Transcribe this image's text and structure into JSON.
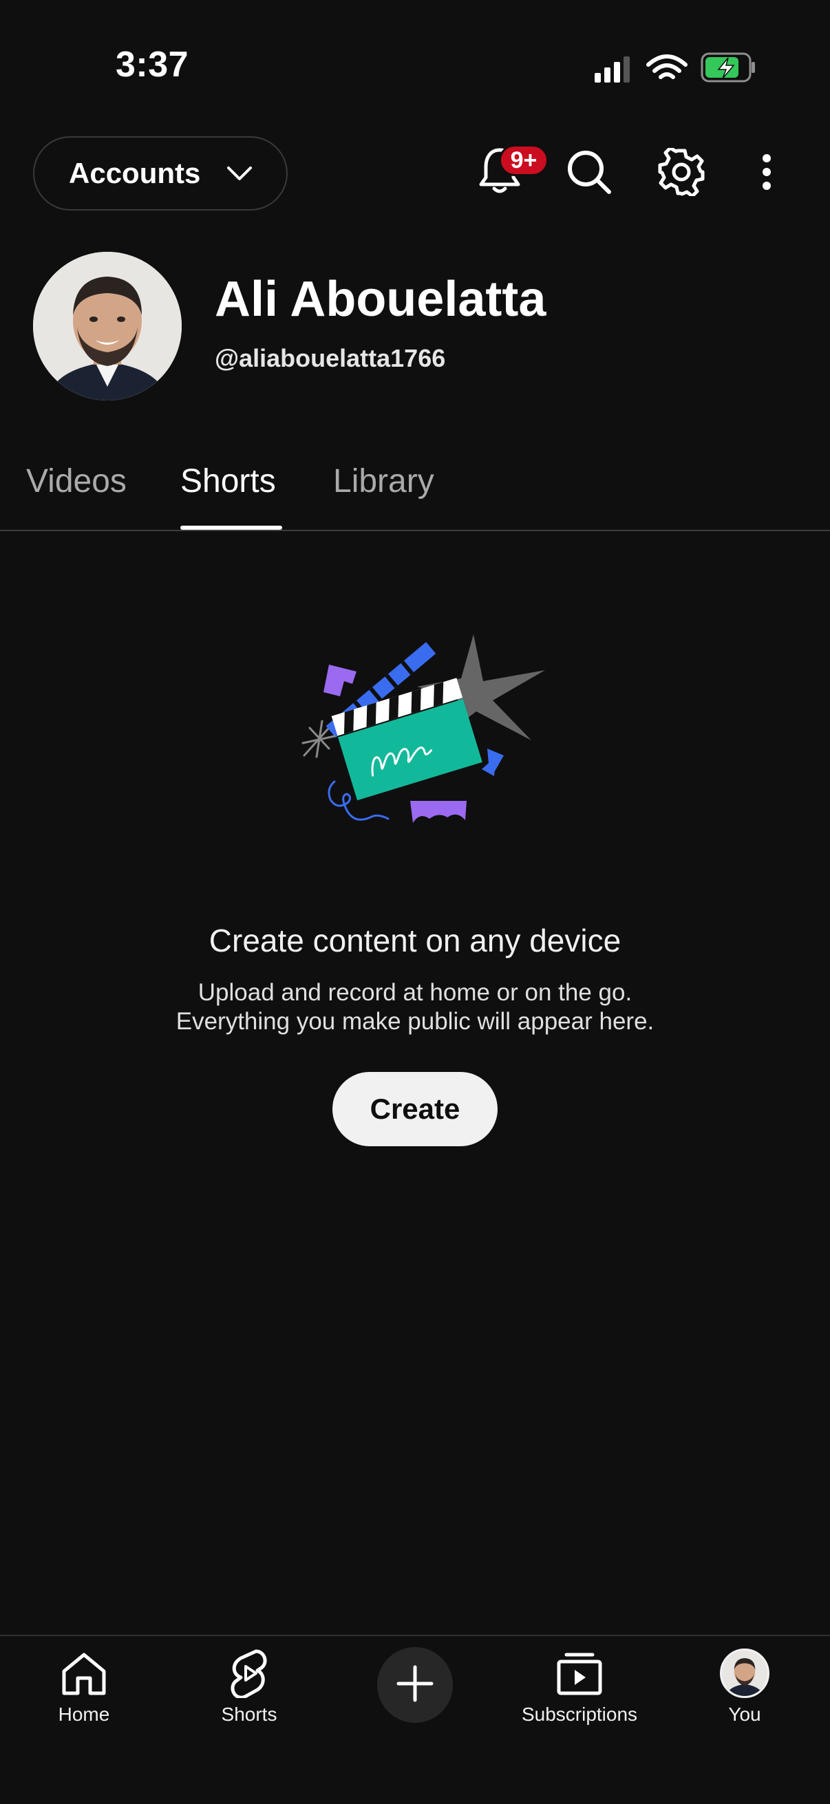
{
  "status_bar": {
    "time": "3:37",
    "icons": [
      "cellular-signal-icon",
      "wifi-icon",
      "battery-charging-icon"
    ],
    "battery_color": "#34c759"
  },
  "header": {
    "accounts_label": "Accounts",
    "notification_badge": "9+",
    "badge_color": "#cc0d1f",
    "icons": [
      "bell-icon",
      "search-icon",
      "gear-icon",
      "more-vertical-icon"
    ]
  },
  "profile": {
    "name": "Ali Abouelatta",
    "handle": "@aliabouelatta1766"
  },
  "tabs": [
    {
      "label": "Videos",
      "active": false
    },
    {
      "label": "Shorts",
      "active": true
    },
    {
      "label": "Library",
      "active": false
    }
  ],
  "empty_state": {
    "title": "Create content on any device",
    "line1": "Upload and record at home or on the go.",
    "line2": "Everything you make public will appear here.",
    "button_label": "Create"
  },
  "bottom_nav": {
    "items": [
      {
        "label": "Home",
        "icon": "home-icon"
      },
      {
        "label": "Shorts",
        "icon": "shorts-icon"
      },
      {
        "label": "",
        "icon": "plus-icon"
      },
      {
        "label": "Subscriptions",
        "icon": "subscriptions-icon"
      },
      {
        "label": "You",
        "icon": "avatar"
      }
    ]
  },
  "colors": {
    "background": "#0f0f0f",
    "text": "#f1f1f1",
    "muted_text": "#aaaaaa",
    "illustration_teal": "#12b89a",
    "illustration_blue": "#3a6cf0",
    "illustration_purple": "#9a6af0"
  }
}
